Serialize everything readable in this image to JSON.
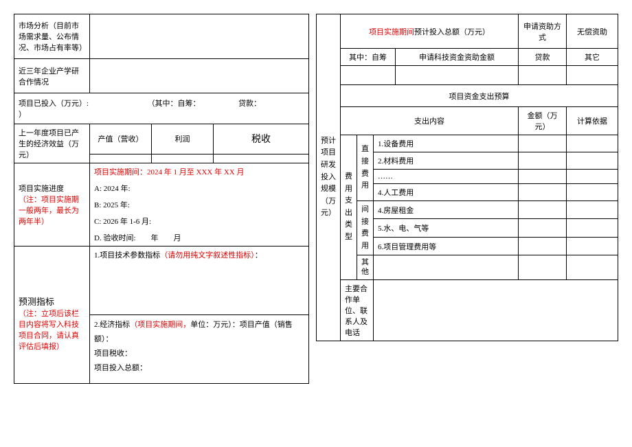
{
  "left": {
    "market_label": "市场分析（目前市场需求量、公布情况、市场占有率等）",
    "coop_label": "近三年企业产学研合作情况",
    "invested_label": "项目已投入（万元）:",
    "invested_mid": "（其中：自筹：",
    "invested_loan": "贷款：",
    "invested_end": "）",
    "lastyear_label": "上一年度项目已产生的经济效益（万元）",
    "output_label": "产值（营收）",
    "profit_label": "利润",
    "tax_label": "税收",
    "progress_label": "项目实施进度",
    "progress_note": "（注：项目实施期一般两年，最长为两年半）",
    "period_label": "项目实施期间：2024 年 1 月至 XXX 年 XX 月",
    "a_line": "A: 2024 年:",
    "b_line": "B: 2025 年:",
    "c_line": "C: 2026 年 1-6 月:",
    "d_line": "D. 验收时间:  年  月",
    "forecast_label": "预测指标",
    "forecast_note": "（注：立项后该栏目内容将写入科技项目合同，请认真评估后填报）",
    "tech_idx_label": "1.项目技术参数指标",
    "tech_idx_note": "（请勿用纯文字叙述性指标）",
    "tech_idx_colon": "：",
    "econ_idx_label": "2.经济指标",
    "econ_idx_note": "（项目实施期间，",
    "econ_unit": "单位：万元）：项目产值（销售额）：",
    "econ_tax": "项目税收：",
    "econ_total": "项目投入总额："
  },
  "right": {
    "scale_label": "预计项目研发投入规模（万元）",
    "header_period": "项目实施期间",
    "header_total": "预计投入总额（万元）",
    "fund_method": "申请资助方式",
    "free_grant": "无偿资助",
    "self_raised": "其中：自筹",
    "tech_fund": "申请科技资金资助金额",
    "loan": "贷款",
    "other": "其它",
    "budget_title": "项目资金支出预算",
    "expense_content": "支出内容",
    "amount": "金额（万元）",
    "basis": "计算依据",
    "expense_type": "费用支出类型",
    "direct": "直接费用",
    "item1": "1.设备费用",
    "item2": "2.材料费用",
    "item_dots": "……",
    "item4": "4.人工费用",
    "indirect": "间接费用",
    "item_house": "4.房屋租金",
    "item_utility": "5.水、电、气等",
    "item_mgmt": "6.项目管理费用等",
    "other_type": "其他",
    "coop_unit": "主要合作单位、联系人及电话"
  }
}
